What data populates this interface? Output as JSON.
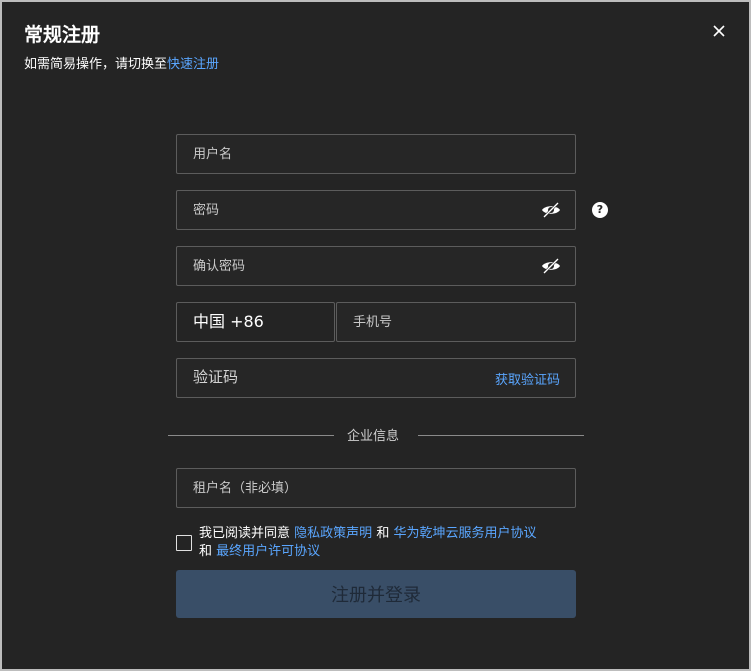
{
  "dialog": {
    "title": "常规注册",
    "subtitle_prefix": "如需简易操作，请切换至",
    "subtitle_link": "快速注册",
    "close_icon": "close-icon"
  },
  "form": {
    "username_placeholder": "用户名",
    "password_placeholder": "密码",
    "confirm_password_placeholder": "确认密码",
    "password_visibility_icon": "eye-off-icon",
    "help_icon_glyph": "?",
    "country_code": "中国 +86",
    "phone_placeholder": "手机号",
    "code_placeholder": "验证码",
    "get_code_label": "获取验证码",
    "section_label": "企业信息",
    "tenant_placeholder": "租户名（非必填）"
  },
  "agreement": {
    "prefix": "我已阅读并同意",
    "link_privacy": "隐私政策声明",
    "and1": "和",
    "link_service": "华为乾坤云服务用户协议",
    "and2": "和",
    "link_eula": "最终用户许可协议",
    "checked": false
  },
  "submit_label": "注册并登录",
  "colors": {
    "background": "#242424",
    "link": "#5aa6ff",
    "submit_bg": "#394e67",
    "field_border": "#5c5c5c"
  }
}
